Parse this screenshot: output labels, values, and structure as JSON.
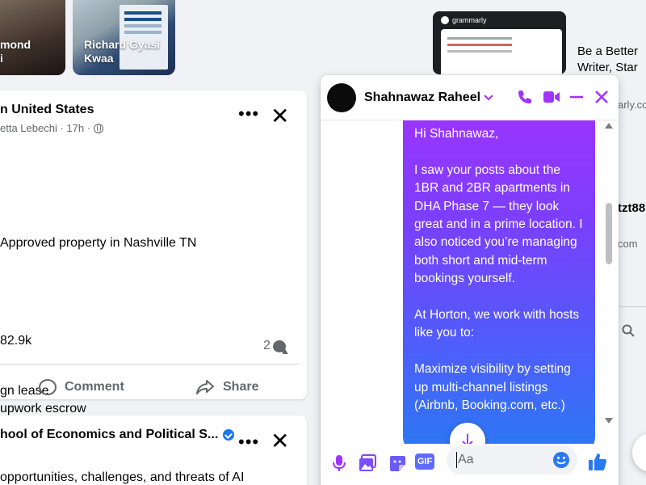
{
  "stories": [
    {
      "name": "mond\ni"
    },
    {
      "name": "Richard Gyasi\nKwaa"
    }
  ],
  "post1": {
    "title": "n United States",
    "subtitle": "etta Lebechi · 17h ·",
    "lines": [
      "Approved property in Nashville TN",
      "82.9k",
      "gn lease",
      "upwork escrow"
    ],
    "comment_count": "2",
    "actions": {
      "comment": "Comment",
      "share": "Share"
    }
  },
  "post2": {
    "title": "hool of Economics and Political S...",
    "text": "opportunities, challenges, and threats of AI"
  },
  "sponsored": {
    "brand": "grammarly",
    "title_line1": "Be a Better",
    "title_line2": "Writer, Star",
    "domain": "arly.co"
  },
  "contacts": {
    "name": "tzt88",
    "sub": "com"
  },
  "chat": {
    "name": "Shahnawaz Raheel",
    "message": [
      "Hi Shahnawaz,",
      "I saw your posts about the 1BR and 2BR apartments in DHA Phase 7 — they look great and in a prime location. I also noticed you’re managing both short and mid-term bookings yourself.",
      "At Horton, we work with hosts like you to:",
      "Maximize visibility by setting up multi-channel listings (Airbnb, Booking.com, etc.)"
    ],
    "input_placeholder": "Aa",
    "gif_label": "GIF"
  },
  "colors": {
    "accent": "#a033ff",
    "blue": "#1877f2",
    "gradient_top": "#a033ff",
    "gradient_bottom": "#2b78f3"
  }
}
